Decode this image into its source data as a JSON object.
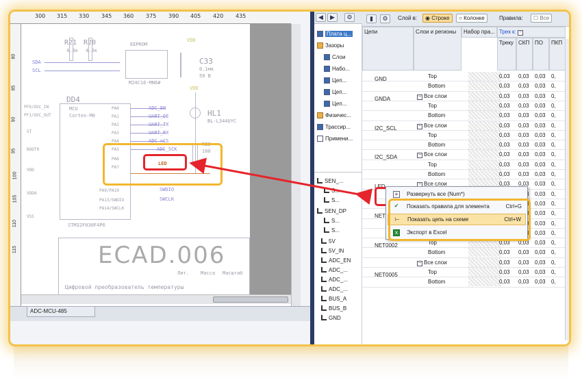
{
  "schematic": {
    "ruler_top": [
      "300",
      "315",
      "330",
      "345",
      "360",
      "375",
      "390",
      "405",
      "420",
      "435"
    ],
    "ruler_left": [
      "80",
      "85",
      "90",
      "95",
      "100",
      "105",
      "110",
      "115"
    ],
    "components": {
      "r21": "R21",
      "r20": "R20",
      "r21_val": "4.3к",
      "r20_val": "4.3к",
      "eeprom": "EEPROM",
      "eeprom_part": "M24C16-MN6#",
      "vdd1": "VDD",
      "vdd2": "VDD",
      "c33": "C33",
      "c33_val": "0.1мк",
      "c33_volt": "50 В",
      "d04": "DD4",
      "mcu": "MCU",
      "cortex": "Cortex-M0",
      "hl1": "HL1",
      "hl1_part": "BL-L344UYC",
      "r22": "R22",
      "r22_val": "100",
      "mcu_part": "STM32F030F4P6",
      "sda": "SDA",
      "scl": "SCL"
    },
    "nets": [
      "ADC_EN",
      "UART_DE",
      "UART_TX",
      "UART_RX",
      "ADC_nCS",
      "ADC_SCK",
      "LED",
      "SWDIO",
      "SWCLK"
    ],
    "pins": [
      "PA0",
      "PA1",
      "PA2",
      "PA3",
      "PA4",
      "PA5",
      "PA6",
      "PA7",
      "PA9/PA10",
      "PA13/SWDIO",
      "PA14/SWCLK"
    ],
    "pins_left": [
      "PF0/OSC_IN",
      "PF1/OSC_OUT",
      "ST",
      "BOOT0",
      "VDD",
      "VDDA",
      "VSS"
    ],
    "stamp_title": "ECAD.006",
    "stamp_desc": "Цифровой преобразователь температуры",
    "stamp_cols": [
      "Лит.",
      "Масса",
      "Масштаб"
    ],
    "tab_label": "ADC-MCU-485"
  },
  "tree": {
    "items": [
      "Плата ц...",
      "Зазоры",
      "Слои",
      "Набо...",
      "Цеп...",
      "Цеп...",
      "Цеп...",
      "Физичес...",
      "Трассир...",
      "Примени..."
    ],
    "nets": [
      "SEN_...",
      "S...",
      "S...",
      "SEN_DP",
      "S...",
      "S...",
      "5V",
      "5V_IN",
      "ADC_EN",
      "ADC_...",
      "ADC_...",
      "ADC_...",
      "BUS_A",
      "BUS_B",
      "GND"
    ]
  },
  "grid": {
    "toolbar": {
      "layer_label": "Слой в:",
      "by_row": "Строке",
      "by_col": "Колонке",
      "rules_label": "Правила:",
      "all": "Все"
    },
    "headers": {
      "nets": "Цепи",
      "layers": "Слои и регионы",
      "ruleset": "Набор пра...",
      "track": "Трек к:",
      "col1": "Треку",
      "col2": "СКП",
      "col3": "ПО",
      "col4": "ПКП"
    },
    "rows": [
      {
        "net": "GND",
        "layer": "Top",
        "vals": [
          "0,03",
          "0,03",
          "0,03",
          "0,"
        ]
      },
      {
        "net": "",
        "layer": "Bottom",
        "vals": [
          "0,03",
          "0,03",
          "0,03",
          "0,"
        ]
      },
      {
        "net": "GNDA",
        "layer": "Все слои",
        "vals": [
          "0,03",
          "0,03",
          "0,03",
          "0,"
        ]
      },
      {
        "net": "",
        "layer": "Top",
        "vals": [
          "0,03",
          "0,03",
          "0,03",
          "0,"
        ]
      },
      {
        "net": "",
        "layer": "Bottom",
        "vals": [
          "0,03",
          "0,03",
          "0,03",
          "0,"
        ]
      },
      {
        "net": "I2C_SCL",
        "layer": "Все слои",
        "vals": [
          "0,03",
          "0,03",
          "0,03",
          "0,"
        ]
      },
      {
        "net": "",
        "layer": "Top",
        "vals": [
          "0,03",
          "0,03",
          "0,03",
          "0,"
        ]
      },
      {
        "net": "",
        "layer": "Bottom",
        "vals": [
          "0,03",
          "0,03",
          "0,03",
          "0,"
        ]
      },
      {
        "net": "I2C_SDA",
        "layer": "Все слои",
        "vals": [
          "0,03",
          "0,03",
          "0,03",
          "0,"
        ]
      },
      {
        "net": "",
        "layer": "Top",
        "vals": [
          "0,03",
          "0,03",
          "0,03",
          "0,"
        ]
      },
      {
        "net": "",
        "layer": "Bottom",
        "vals": [
          "0,03",
          "0,03",
          "0,03",
          "0,"
        ]
      },
      {
        "net": "LED",
        "layer": "Все слои",
        "vals": [
          "0,03",
          "0,03",
          "0,03",
          "0,"
        ]
      },
      {
        "net": "",
        "layer": "",
        "vals": [
          "",
          "0,03",
          "0,03",
          "0,"
        ]
      },
      {
        "net": "",
        "layer": "",
        "vals": [
          "",
          "0,03",
          "0,03",
          "0,"
        ]
      },
      {
        "net": "NET0001",
        "layer": "",
        "vals": [
          "",
          "0,03",
          "0,03",
          "0,"
        ]
      },
      {
        "net": "",
        "layer": "",
        "vals": [
          "",
          "0,03",
          "0,03",
          "0,"
        ]
      },
      {
        "net": "",
        "layer": "",
        "vals": [
          "0,03",
          "0,03",
          "0,03",
          "0,"
        ]
      },
      {
        "net": "NET0002",
        "layer": "Top",
        "vals": [
          "0,03",
          "0,03",
          "0,03",
          "0,"
        ]
      },
      {
        "net": "",
        "layer": "Bottom",
        "vals": [
          "0,03",
          "0,03",
          "0,03",
          "0,"
        ]
      },
      {
        "net": "",
        "layer": "Все слои",
        "vals": [
          "0,03",
          "0,03",
          "0,03",
          "0,"
        ]
      },
      {
        "net": "NET0005",
        "layer": "Top",
        "vals": [
          "0,03",
          "0,03",
          "0,03",
          "0,"
        ]
      },
      {
        "net": "",
        "layer": "Bottom",
        "vals": [
          "0,03",
          "0,03",
          "0,03",
          "0,"
        ]
      }
    ]
  },
  "context_menu": {
    "items": [
      {
        "label": "Развернуть все (Num*)",
        "shortcut": ""
      },
      {
        "label": "Показать правила для элемента",
        "shortcut": "Ctrl+G"
      },
      {
        "label": "Показать цепь на схеме",
        "shortcut": "Ctrl+W"
      },
      {
        "label": "Экспорт в Excel",
        "shortcut": ""
      }
    ]
  },
  "colors": {
    "highlight": "#f2b72e",
    "red": "#e5242b",
    "selected": "#3c78c8"
  }
}
